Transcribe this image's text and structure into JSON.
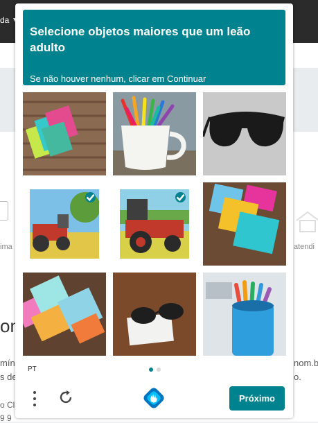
{
  "background": {
    "topbar_text": "da ▼",
    "left_labels": [
      "ima",
      "om",
      "mín",
      "s de",
      "o Cl",
      "9 9"
    ],
    "right_labels": [
      "atendi",
      "nom.b",
      "o."
    ]
  },
  "challenge": {
    "title": "Selecione objetos maiores que um leão adulto",
    "subtitle": "Se não houver nenhum, clicar em Continuar",
    "accent_color": "#00838f",
    "tiles": [
      {
        "subject": "colorful paper notes on wooden table",
        "selected": false
      },
      {
        "subject": "mug with colored pencils",
        "selected": false
      },
      {
        "subject": "black sunglasses",
        "selected": false
      },
      {
        "subject": "red tractor in field",
        "selected": true
      },
      {
        "subject": "red tractor in field",
        "selected": true
      },
      {
        "subject": "colorful paper notes",
        "selected": false
      },
      {
        "subject": "colorful paper notes on wooden table",
        "selected": false
      },
      {
        "subject": "sunglasses on wooden table",
        "selected": false
      },
      {
        "subject": "pencil cup with colored pencils",
        "selected": false
      }
    ],
    "language": "PT",
    "page_dots": 2,
    "active_page": 1,
    "next_label": "Próximo"
  }
}
